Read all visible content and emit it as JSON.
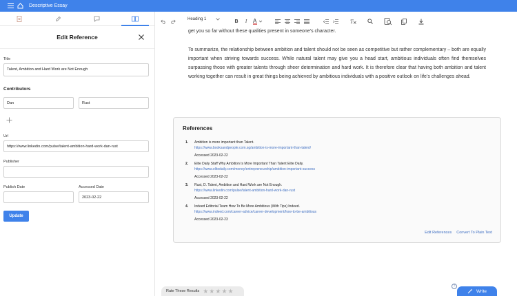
{
  "app": {
    "title": "Descriptive Essay"
  },
  "panel": {
    "heading": "Edit Reference",
    "title_label": "Title",
    "title_value": "Talent, Ambition and Hard Work are Not Enough",
    "contributors_heading": "Contributors",
    "contributor_first": "Dan",
    "contributor_last": "Rust",
    "url_label": "Url",
    "url_value": "https://www.linkedin.com/pulse/talent-ambition-hard-work-dan-rust",
    "publisher_label": "Publisher",
    "publisher_value": "",
    "publish_date_label": "Publish Date",
    "publish_date_value": "",
    "accessed_date_label": "Accessed Date",
    "accessed_date_value": "2023-02-22",
    "update_label": "Update"
  },
  "toolbar": {
    "heading_value": "Heading 1"
  },
  "document": {
    "para0": "get you so far without these qualities present in someone’s character.",
    "para1": "To summarize, the relationship between ambition and talent should not be seen as competitive but rather complementary – both are equally important when striving towards success. While natural talent may give you a head start, ambitious individuals often find themselves surpassing those with greater talents through sheer determination and hard work. It is therefore clear that having both ambition and talent working together can result in great things being achieved by ambitious individuals with a positive outlook on life’s challenges ahead."
  },
  "references": {
    "heading": "References",
    "items": [
      {
        "num": "1.",
        "title": "Ambition is more important than Talent.",
        "url": "https://www.booksandpeople.com.sg/ambition-is-more-important-than-talent/",
        "accessed": "Accessed 2023-02-22"
      },
      {
        "num": "2.",
        "title": "Elite Daily Staff Why Ambition Is More Important Than Talent Elite Daily.",
        "url": "https://www.elitedaily.com/money/entrepreneurship/ambition-important-success",
        "accessed": "Accessed 2023-02-22"
      },
      {
        "num": "3.",
        "title": "Rust, D. Talent, Ambition and Hard Work are Not Enough.",
        "url": "https://www.linkedin.com/pulse/talent-ambition-hard-work-dan-rust",
        "accessed": "Accessed 2023-02-22"
      },
      {
        "num": "4.",
        "title": "Indeed Editorial Team How To Be More Ambitious (With Tips) Indeed.",
        "url": "https://www.indeed.com/career-advice/career-development/how-to-be-ambitious",
        "accessed": "Accessed 2023-02-23"
      }
    ],
    "edit_label": "Edit References",
    "convert_label": "Convert To Plain Text"
  },
  "footer": {
    "rate_label": "Rate These Results",
    "write_label": "Write",
    "help_label": "?"
  }
}
